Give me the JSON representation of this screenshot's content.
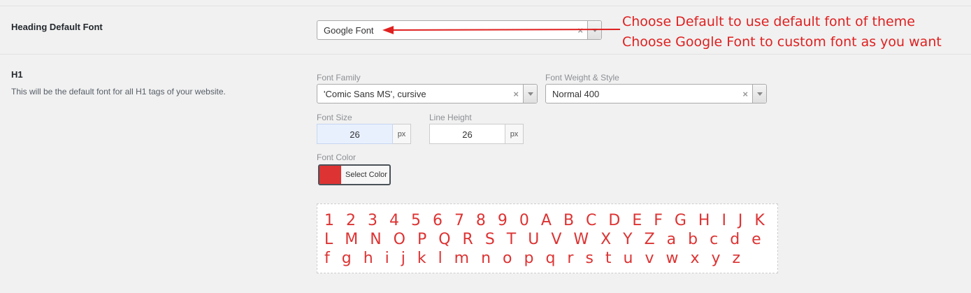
{
  "heading_default_font": {
    "label": "Heading Default Font",
    "selected": "Google Font",
    "clear_glyph": "×"
  },
  "annotation": {
    "line1": "Choose Default to use default font of theme",
    "line2": "Choose Google Font to custom font as you want",
    "color": "#e02020"
  },
  "h1": {
    "label": "H1",
    "description": "This will be the default font for all H1 tags of your website.",
    "font_family": {
      "label": "Font Family",
      "value": "'Comic Sans MS', cursive",
      "clear_glyph": "×"
    },
    "font_weight": {
      "label": "Font Weight & Style",
      "value": "Normal 400",
      "clear_glyph": "×"
    },
    "font_size": {
      "label": "Font Size",
      "value": "26",
      "unit": "px"
    },
    "line_height": {
      "label": "Line Height",
      "value": "26",
      "unit": "px"
    },
    "font_color": {
      "label": "Font Color",
      "button_label": "Select Color",
      "swatch": "#dd3333"
    },
    "preview_text": "1 2 3 4 5 6 7 8 9 0 A B C D E F G H I J K L M N O P Q R S T U V W X Y Z a b c d e f g h i j k l m n o p q r s t u v w x y z"
  }
}
